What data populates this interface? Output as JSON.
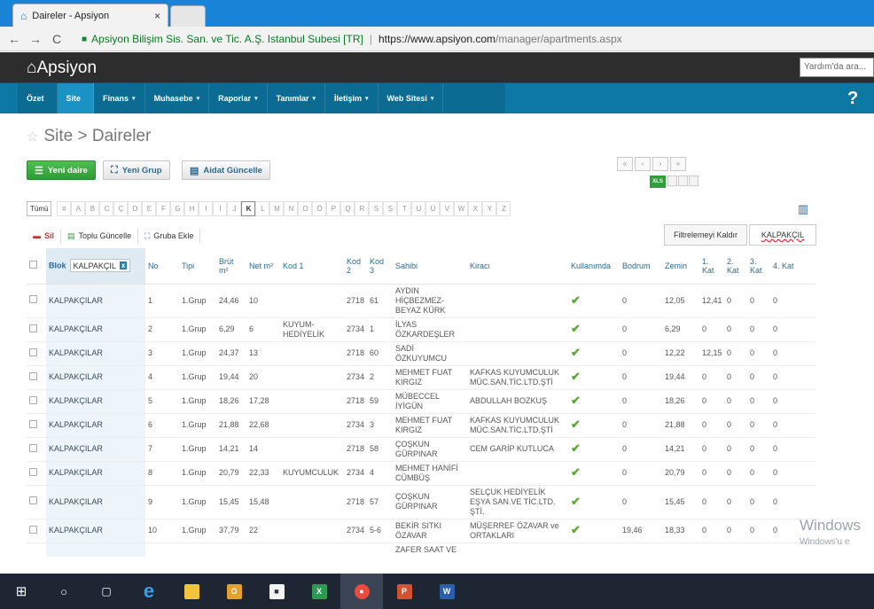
{
  "browser": {
    "tab_title": "Daireler - Apsiyon",
    "tab_close": "×",
    "org": "Apsiyon Bilişim Sis. San. ve Tic. A.Ş. Istanbul Subesi [TR]",
    "url_host": "https://www.apsiyon.com",
    "url_path": "/manager/apartments.aspx"
  },
  "app": {
    "logo": "⌂Apsiyon",
    "help_placeholder": "Yardım'da ara...",
    "help_mark": "?"
  },
  "menu": [
    {
      "label": "Özet",
      "caret": ""
    },
    {
      "label": "Site",
      "caret": ""
    },
    {
      "label": "Finans",
      "caret": "▾"
    },
    {
      "label": "Muhasebe",
      "caret": "▾"
    },
    {
      "label": "Raporlar",
      "caret": "▾"
    },
    {
      "label": "Tanımlar",
      "caret": "▾"
    },
    {
      "label": "İletişim",
      "caret": "▾"
    },
    {
      "label": "Web Sitesi",
      "caret": "▾"
    }
  ],
  "page": {
    "title": "Site > Daireler"
  },
  "toolbar": {
    "new_unit": "Yeni daire",
    "new_group": "Yeni Grup",
    "update_dues": "Aidat Güncelle"
  },
  "pager": {
    "first": "«",
    "prev": "‹",
    "next": "›",
    "last": "»",
    "xls": "XLS"
  },
  "alphabet": [
    "Tümü",
    "#",
    "A",
    "B",
    "C",
    "Ç",
    "D",
    "E",
    "F",
    "G",
    "H",
    "I",
    "İ",
    "J",
    "K",
    "L",
    "M",
    "N",
    "O",
    "Ö",
    "P",
    "Q",
    "R",
    "S",
    "Ş",
    "T",
    "U",
    "Ü",
    "V",
    "W",
    "X",
    "Y",
    "Z"
  ],
  "actions": {
    "delete": "Sil",
    "bulk_update": "Toplu Güncelle",
    "add_to_group": "Gruba Ekle"
  },
  "filter": {
    "clear": "Filtrelemeyi Kaldır",
    "value": "KALPAKÇIL",
    "block_filter": "KALPAKÇIL",
    "block_filter_clear": "x"
  },
  "table": {
    "headers": {
      "blok": "Blok",
      "no": "No",
      "tipi": "Tipi",
      "brut": "Brüt m²",
      "net": "Net m²",
      "kod1": "Kod 1",
      "kod2": "Kod 2",
      "kod3": "Kod 3",
      "sahibi": "Sahibi",
      "kiraci": "Kiracı",
      "kullanimda": "Kullanımda",
      "bodrum": "Bodrum",
      "zemin": "Zemin",
      "kat1": "1. Kat",
      "kat2": "2. Kat",
      "kat3": "3. Kat",
      "kat4": "4. Kat"
    },
    "rows": [
      {
        "blok": "KALPAKÇILAR",
        "no": "1",
        "tipi": "1.Grup",
        "brut": "24,46",
        "net": "10",
        "kod1": "",
        "kod2": "2718",
        "kod3": "61",
        "sahibi": "AYDIN HİÇBEZMEZ-BEYAZ KÜRK",
        "kiraci": "",
        "bodrum": "0",
        "zemin": "12,05",
        "k1": "12,41",
        "k2": "0",
        "k3": "0",
        "k4": "0"
      },
      {
        "blok": "KALPAKÇILAR",
        "no": "2",
        "tipi": "1.Grup",
        "brut": "6,29",
        "net": "6",
        "kod1": "KUYUM-HEDİYELİK",
        "kod2": "2734",
        "kod3": "1",
        "sahibi": "İLYAS ÖZKARDEŞLER",
        "kiraci": "",
        "bodrum": "0",
        "zemin": "6,29",
        "k1": "0",
        "k2": "0",
        "k3": "0",
        "k4": "0"
      },
      {
        "blok": "KALPAKÇILAR",
        "no": "3",
        "tipi": "1.Grup",
        "brut": "24,37",
        "net": "13",
        "kod1": "",
        "kod2": "2718",
        "kod3": "60",
        "sahibi": "SADİ ÖZKUYUMCU",
        "kiraci": "",
        "bodrum": "0",
        "zemin": "12,22",
        "k1": "12,15",
        "k2": "0",
        "k3": "0",
        "k4": "0"
      },
      {
        "blok": "KALPAKÇILAR",
        "no": "4",
        "tipi": "1.Grup",
        "brut": "19,44",
        "net": "20",
        "kod1": "",
        "kod2": "2734",
        "kod3": "2",
        "sahibi": "MEHMET FUAT KIRGIZ",
        "kiraci": "KAFKAS KUYUMCULUK MÜC.SAN.TİC.LTD.ŞTİ",
        "bodrum": "0",
        "zemin": "19,44",
        "k1": "0",
        "k2": "0",
        "k3": "0",
        "k4": "0"
      },
      {
        "blok": "KALPAKÇILAR",
        "no": "5",
        "tipi": "1.Grup",
        "brut": "18,26",
        "net": "17,28",
        "kod1": "",
        "kod2": "2718",
        "kod3": "59",
        "sahibi": "MÜBECCEL İYİGÜN",
        "kiraci": "ABDULLAH BOZKUŞ",
        "bodrum": "0",
        "zemin": "18,26",
        "k1": "0",
        "k2": "0",
        "k3": "0",
        "k4": "0"
      },
      {
        "blok": "KALPAKÇILAR",
        "no": "6",
        "tipi": "1.Grup",
        "brut": "21,88",
        "net": "22,68",
        "kod1": "",
        "kod2": "2734",
        "kod3": "3",
        "sahibi": "MEHMET FUAT KIRGIZ",
        "kiraci": "KAFKAS KUYUMCULUK MÜC.SAN.TİC.LTD.ŞTİ",
        "bodrum": "0",
        "zemin": "21,88",
        "k1": "0",
        "k2": "0",
        "k3": "0",
        "k4": "0"
      },
      {
        "blok": "KALPAKÇILAR",
        "no": "7",
        "tipi": "1.Grup",
        "brut": "14,21",
        "net": "14",
        "kod1": "",
        "kod2": "2718",
        "kod3": "58",
        "sahibi": "ÇOŞKUN GÜRPINAR",
        "kiraci": "CEM GARİP KUTLUCA",
        "bodrum": "0",
        "zemin": "14,21",
        "k1": "0",
        "k2": "0",
        "k3": "0",
        "k4": "0"
      },
      {
        "blok": "KALPAKÇILAR",
        "no": "8",
        "tipi": "1.Grup",
        "brut": "20,79",
        "net": "22,33",
        "kod1": "KUYUMCULUK",
        "kod2": "2734",
        "kod3": "4",
        "sahibi": "MEHMET HANİFİ CÜMBÜŞ",
        "kiraci": "",
        "bodrum": "0",
        "zemin": "20,79",
        "k1": "0",
        "k2": "0",
        "k3": "0",
        "k4": "0"
      },
      {
        "blok": "KALPAKÇILAR",
        "no": "9",
        "tipi": "1.Grup",
        "brut": "15,45",
        "net": "15,48",
        "kod1": "",
        "kod2": "2718",
        "kod3": "57",
        "sahibi": "ÇOŞKUN GÜRPINAR",
        "kiraci": "SELÇUK HEDİYELİK EŞYA SAN.VE TİC.LTD. ŞTİ.",
        "bodrum": "0",
        "zemin": "15,45",
        "k1": "0",
        "k2": "0",
        "k3": "0",
        "k4": "0"
      },
      {
        "blok": "KALPAKÇILAR",
        "no": "10",
        "tipi": "1.Grup",
        "brut": "37,79",
        "net": "22",
        "kod1": "",
        "kod2": "2734",
        "kod3": "5-6",
        "sahibi": "BEKİR SITKI ÖZAVAR",
        "kiraci": "MÜŞERREF ÖZAVAR ve ORTAKLARI",
        "bodrum": "19,46",
        "zemin": "18,33",
        "k1": "0",
        "k2": "0",
        "k3": "0",
        "k4": "0"
      }
    ],
    "partial_owner": "ZAFER SAAT VE"
  },
  "watermark": {
    "line1": "Windows",
    "line2": "Windows'u e"
  },
  "taskbar": [
    "windows-start-icon",
    "search-icon",
    "task-view-icon",
    "edge-icon",
    "file-explorer-icon",
    "outlook-icon",
    "store-icon",
    "excel-icon",
    "chrome-icon",
    "powerpoint-icon",
    "word-icon"
  ],
  "colors": {
    "menu": "#0d78a3",
    "active_tab": "#1b92c4",
    "new_button": "#3aaa3f",
    "title_bar": "#1883d7"
  }
}
